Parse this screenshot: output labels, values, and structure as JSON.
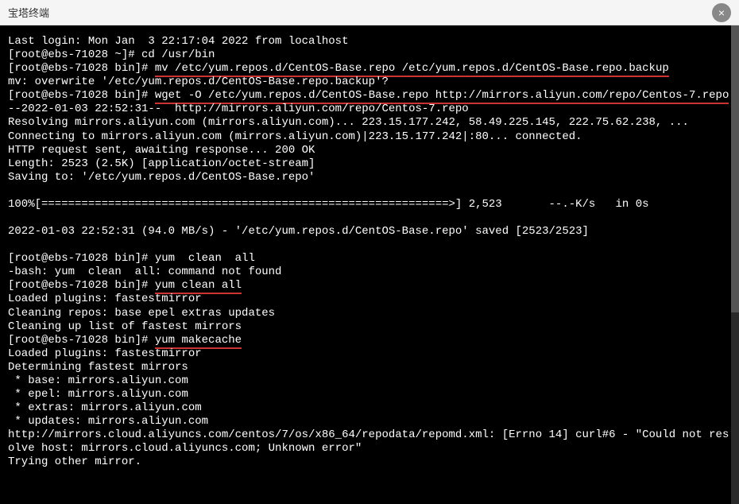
{
  "titlebar": {
    "title": "宝塔终端",
    "close": "×"
  },
  "terminal": {
    "lines": [
      {
        "t": "Last login: Mon Jan  3 22:17:04 2022 from localhost"
      },
      {
        "t": "[root@ebs-71028 ~]# cd /usr/bin"
      },
      {
        "prefix": "[root@ebs-71028 bin]# ",
        "cmd": "mv /etc/yum.repos.d/CentOS-Base.repo /etc/yum.repos.d/CentOS-Base.repo.backup",
        "u": true
      },
      {
        "t": "mv: overwrite '/etc/yum.repos.d/CentOS-Base.repo.backup'?"
      },
      {
        "prefix": "[root@ebs-71028 bin]# ",
        "cmd": "wget -O /etc/yum.repos.d/CentOS-Base.repo http://mirrors.aliyun.com/repo/Centos-7.repo",
        "u": true
      },
      {
        "t": "--2022-01-03 22:52:31--  http://mirrors.aliyun.com/repo/Centos-7.repo"
      },
      {
        "t": "Resolving mirrors.aliyun.com (mirrors.aliyun.com)... 223.15.177.242, 58.49.225.145, 222.75.62.238, ..."
      },
      {
        "t": "Connecting to mirrors.aliyun.com (mirrors.aliyun.com)|223.15.177.242|:80... connected."
      },
      {
        "t": "HTTP request sent, awaiting response... 200 OK"
      },
      {
        "t": "Length: 2523 (2.5K) [application/octet-stream]"
      },
      {
        "t": "Saving to: '/etc/yum.repos.d/CentOS-Base.repo'"
      },
      {
        "t": ""
      },
      {
        "t": "100%[=============================================================>] 2,523       --.-K/s   in 0s"
      },
      {
        "t": ""
      },
      {
        "t": "2022-01-03 22:52:31 (94.0 MB/s) - '/etc/yum.repos.d/CentOS-Base.repo' saved [2523/2523]"
      },
      {
        "t": ""
      },
      {
        "t": "[root@ebs-71028 bin]# yum  clean  all"
      },
      {
        "t": "-bash: yum  clean  all: command not found"
      },
      {
        "prefix": "[root@ebs-71028 bin]# ",
        "cmd": "yum clean all",
        "u": true
      },
      {
        "t": "Loaded plugins: fastestmirror"
      },
      {
        "t": "Cleaning repos: base epel extras updates"
      },
      {
        "t": "Cleaning up list of fastest mirrors"
      },
      {
        "prefix": "[root@ebs-71028 bin]# ",
        "cmd": "yum makecache",
        "u": true
      },
      {
        "t": "Loaded plugins: fastestmirror"
      },
      {
        "t": "Determining fastest mirrors"
      },
      {
        "t": " * base: mirrors.aliyun.com"
      },
      {
        "t": " * epel: mirrors.aliyun.com"
      },
      {
        "t": " * extras: mirrors.aliyun.com"
      },
      {
        "t": " * updates: mirrors.aliyun.com"
      },
      {
        "t": "http://mirrors.cloud.aliyuncs.com/centos/7/os/x86_64/repodata/repomd.xml: [Errno 14] curl#6 - \"Could not resolve host: mirrors.cloud.aliyuncs.com; Unknown error\""
      },
      {
        "t": "Trying other mirror."
      }
    ]
  }
}
